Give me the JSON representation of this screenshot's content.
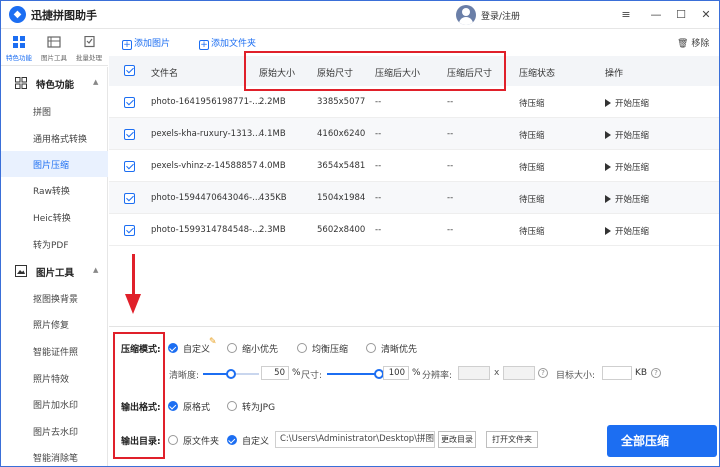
{
  "app": {
    "title": "迅捷拼图助手",
    "login": "登录/注册",
    "window_controls": [
      "≡",
      "—",
      "☐",
      "✕"
    ]
  },
  "tools": [
    {
      "label": "特色功能",
      "icon": "grid-icon",
      "active": true
    },
    {
      "label": "图片工具",
      "icon": "image-tool-icon",
      "active": false
    },
    {
      "label": "批量处理",
      "icon": "batch-icon",
      "active": false
    }
  ],
  "sidebar": {
    "group1": {
      "label": "特色功能",
      "icon": "grid-icon"
    },
    "group1_items": [
      "拼图",
      "通用格式转换",
      "图片压缩",
      "Raw转换",
      "Heic转换",
      "转为PDF"
    ],
    "active_item": "图片压缩",
    "group2": {
      "label": "图片工具",
      "icon": "image-icon"
    },
    "group2_items": [
      "抠图换背景",
      "照片修复",
      "智能证件照",
      "照片特效",
      "图片加水印",
      "图片去水印",
      "智能消除笔"
    ]
  },
  "toolbar": {
    "add_image": "添加图片",
    "add_folder": "添加文件夹",
    "remove": "移除"
  },
  "table": {
    "headers": {
      "name": "文件名",
      "orig_size": "原始大小",
      "orig_dim": "原始尺寸",
      "comp_size": "压缩后大小",
      "comp_dim": "压缩后尺寸",
      "status": "压缩状态",
      "action": "操作"
    },
    "rows": [
      {
        "name": "photo-1641956198771-...",
        "orig_size": "2.2MB",
        "orig_dim": "3385x5077",
        "comp_size": "--",
        "comp_dim": "--",
        "status": "待压缩",
        "action": "开始压缩"
      },
      {
        "name": "pexels-kha-ruxury-1313...",
        "orig_size": "4.1MB",
        "orig_dim": "4160x6240",
        "comp_size": "--",
        "comp_dim": "--",
        "status": "待压缩",
        "action": "开始压缩"
      },
      {
        "name": "pexels-vhinz-z-14588857",
        "orig_size": "4.0MB",
        "orig_dim": "3654x5481",
        "comp_size": "--",
        "comp_dim": "--",
        "status": "待压缩",
        "action": "开始压缩"
      },
      {
        "name": "photo-1594470643046-...",
        "orig_size": "435KB",
        "orig_dim": "1504x1984",
        "comp_size": "--",
        "comp_dim": "--",
        "status": "待压缩",
        "action": "开始压缩"
      },
      {
        "name": "photo-1599314784548-...",
        "orig_size": "2.3MB",
        "orig_dim": "5602x8400",
        "comp_size": "--",
        "comp_dim": "--",
        "status": "待压缩",
        "action": "开始压缩"
      }
    ]
  },
  "settings": {
    "mode_label": "压缩模式:",
    "modes": [
      "自定义",
      "缩小优先",
      "均衡压缩",
      "清晰优先"
    ],
    "clarity_label": "清晰度:",
    "clarity_value": "50",
    "clarity_unit": "%",
    "clarity_fraction": 0.5,
    "size_label": "尺寸:",
    "size_value": "100",
    "size_unit": "%",
    "size_fraction": 1.0,
    "resolution_label": "分辨率:",
    "resolution_sep": "x",
    "target_label": "目标大小:",
    "target_unit": "KB",
    "format_label": "输出格式:",
    "formats": [
      "原格式",
      "转为JPG"
    ],
    "dir_label": "输出目录:",
    "dirs": [
      "原文件夹",
      "自定义"
    ],
    "path": "C:\\Users\\Administrator\\Desktop\\拼图",
    "change_dir": "更改目录",
    "open_folder": "打开文件夹",
    "start_all": "全部压缩"
  },
  "colors": {
    "accent": "#1c6ef2",
    "annotation": "#e0202a"
  }
}
